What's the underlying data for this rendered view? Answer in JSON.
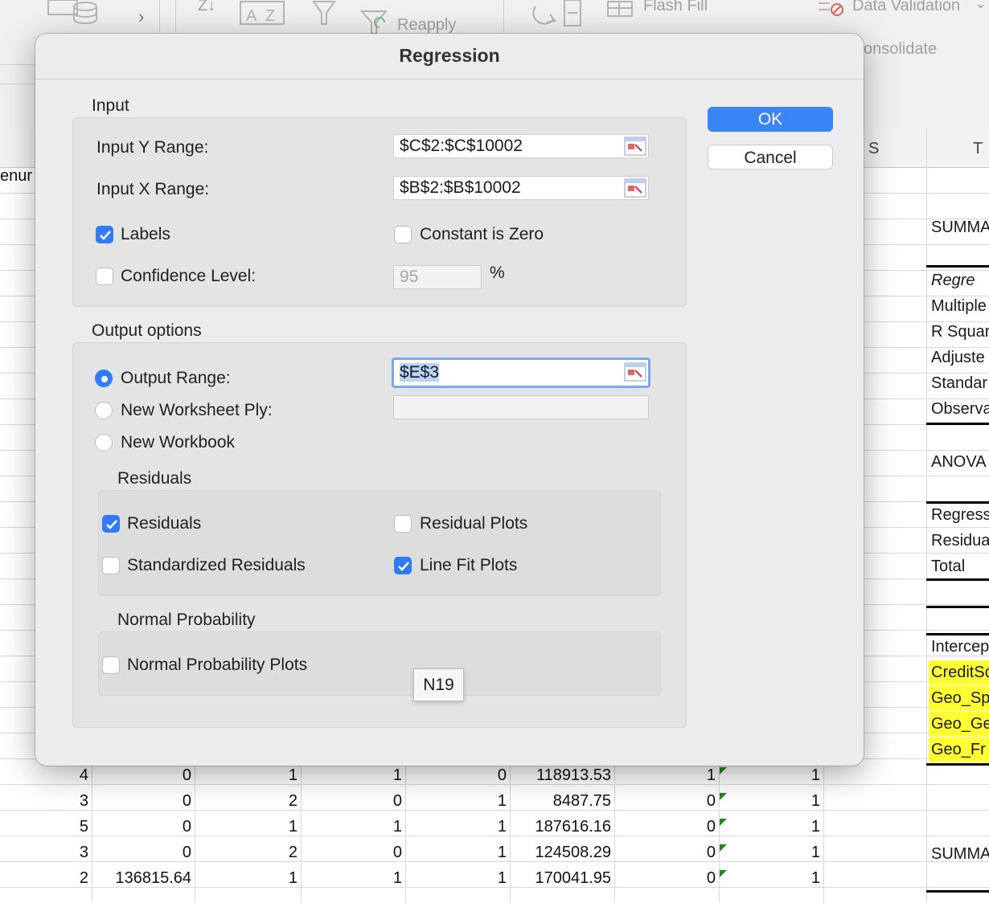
{
  "ribbon": {
    "reapply": "Reapply",
    "flash_fill": "Flash Fill",
    "data_validation": "Data Validation",
    "consolidate": "onsolidate"
  },
  "sheet": {
    "col_s": "S",
    "col_t": "T",
    "left_partial": "enur",
    "rows": [
      {
        "a": "4",
        "b": "0",
        "c": "1",
        "d": "1",
        "e": "0",
        "f": "118913.53",
        "g": "1",
        "h": "1"
      },
      {
        "a": "3",
        "b": "0",
        "c": "2",
        "d": "0",
        "e": "1",
        "f": "8487.75",
        "g": "0",
        "h": "1"
      },
      {
        "a": "5",
        "b": "0",
        "c": "1",
        "d": "1",
        "e": "1",
        "f": "187616.16",
        "g": "0",
        "h": "1"
      },
      {
        "a": "3",
        "b": "0",
        "c": "2",
        "d": "0",
        "e": "1",
        "f": "124508.29",
        "g": "0",
        "h": "1"
      },
      {
        "a": "2",
        "b": "136815.64",
        "c": "1",
        "d": "1",
        "e": "1",
        "f": "170041.95",
        "g": "0",
        "h": "1"
      }
    ],
    "summary_column": {
      "summary1": "SUMMA",
      "regression_stats": "Regre",
      "multiple": "Multiple",
      "r_square": "R Squar",
      "adjusted": "Adjuste",
      "standard": "Standar",
      "observations": "Observa",
      "anova": "ANOVA",
      "regression": "Regress",
      "residual": "Residua",
      "total": "Total",
      "intercept": "Intercep",
      "credit": "CreditSc",
      "geo_sp": "Geo_Sp",
      "geo_ge": "Geo_Ge",
      "geo_fr": "Geo_Fr",
      "summary2": "SUMMA"
    }
  },
  "dialog": {
    "title": "Regression",
    "ok": "OK",
    "cancel": "Cancel",
    "input": {
      "title": "Input",
      "y_label": "Input Y Range:",
      "y_value": "$C$2:$C$10002",
      "x_label": "Input X Range:",
      "x_value": "$B$2:$B$10002",
      "labels": "Labels",
      "labels_checked": true,
      "constant_zero": "Constant is Zero",
      "constant_zero_checked": false,
      "confidence": "Confidence Level:",
      "confidence_checked": false,
      "confidence_value": "95",
      "percent": "%"
    },
    "output": {
      "title": "Output options",
      "output_range": "Output Range:",
      "output_range_value": "$E$3",
      "new_ply": "New Worksheet Ply:",
      "new_ply_value": "",
      "new_workbook": "New Workbook",
      "selected": "output_range"
    },
    "residuals": {
      "title": "Residuals",
      "residuals": "Residuals",
      "residuals_checked": true,
      "residual_plots": "Residual Plots",
      "residual_plots_checked": false,
      "standardized": "Standardized Residuals",
      "standardized_checked": false,
      "line_fit": "Line Fit Plots",
      "line_fit_checked": true
    },
    "normal": {
      "title": "Normal Probability",
      "plots": "Normal Probability Plots",
      "plots_checked": false
    },
    "tooltip": "N19"
  },
  "colors": {
    "accent": "#2f7cf6",
    "highlight_yellow": "#ffff33"
  }
}
